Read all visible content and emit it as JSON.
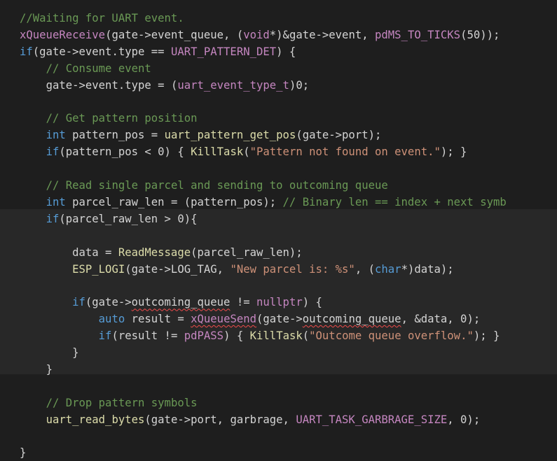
{
  "colors": {
    "background": "#1e1e1e",
    "current_block": "#282828",
    "plain": "#d4d4d4",
    "comment": "#6a9955",
    "function": "#dcdcaa",
    "keyword": "#569cd6",
    "control": "#c586c0",
    "type": "#4ec9b0",
    "string": "#ce9178",
    "number": "#b5cea8",
    "variable": "#9cdcfe",
    "error_squiggle": "#f14c4c"
  },
  "code": {
    "lines": [
      {
        "indent": 0,
        "tokens": [
          {
            "t": "//Waiting for UART event.",
            "c": "comment"
          }
        ]
      },
      {
        "indent": 0,
        "tokens": [
          {
            "t": "xQueueReceive",
            "c": "control"
          },
          {
            "t": "(gate->event_queue, (",
            "c": "plain"
          },
          {
            "t": "void",
            "c": "control"
          },
          {
            "t": "*)&gate->event, ",
            "c": "plain"
          },
          {
            "t": "pdMS_TO_TICKS",
            "c": "control"
          },
          {
            "t": "(50));",
            "c": "plain"
          }
        ]
      },
      {
        "indent": 0,
        "tokens": [
          {
            "t": "if",
            "c": "keyword"
          },
          {
            "t": "(gate->event.type == ",
            "c": "plain"
          },
          {
            "t": "UART_PATTERN_DET",
            "c": "control"
          },
          {
            "t": ") {",
            "c": "plain"
          }
        ]
      },
      {
        "indent": 1,
        "tokens": [
          {
            "t": "// Consume event",
            "c": "comment"
          }
        ]
      },
      {
        "indent": 1,
        "tokens": [
          {
            "t": "gate->event.type = (",
            "c": "plain"
          },
          {
            "t": "uart_event_type_t",
            "c": "control"
          },
          {
            "t": ")0;",
            "c": "plain"
          }
        ]
      },
      {
        "indent": 0,
        "tokens": []
      },
      {
        "indent": 1,
        "tokens": [
          {
            "t": "// Get pattern position",
            "c": "comment"
          }
        ]
      },
      {
        "indent": 1,
        "tokens": [
          {
            "t": "int",
            "c": "keyword"
          },
          {
            "t": " pattern_pos = ",
            "c": "plain"
          },
          {
            "t": "uart_pattern_get_pos",
            "c": "function"
          },
          {
            "t": "(gate->port);",
            "c": "plain"
          }
        ]
      },
      {
        "indent": 1,
        "tokens": [
          {
            "t": "if",
            "c": "keyword"
          },
          {
            "t": "(pattern_pos < 0) { ",
            "c": "plain"
          },
          {
            "t": "KillTask",
            "c": "function"
          },
          {
            "t": "(",
            "c": "plain"
          },
          {
            "t": "\"Pattern not found on event.\"",
            "c": "string"
          },
          {
            "t": "); }",
            "c": "plain"
          }
        ]
      },
      {
        "indent": 0,
        "tokens": []
      },
      {
        "indent": 1,
        "tokens": [
          {
            "t": "// Read single parcel and sending to outcoming queue",
            "c": "comment"
          }
        ]
      },
      {
        "indent": 1,
        "tokens": [
          {
            "t": "int",
            "c": "keyword"
          },
          {
            "t": " parcel_raw_len = (pattern_pos); ",
            "c": "plain"
          },
          {
            "t": "// Binary len == index + next symb",
            "c": "comment"
          }
        ]
      },
      {
        "indent": 1,
        "tokens": [
          {
            "t": "if",
            "c": "keyword"
          },
          {
            "t": "(parcel_raw_len > 0){",
            "c": "plain"
          }
        ]
      },
      {
        "indent": 0,
        "tokens": []
      },
      {
        "indent": 2,
        "tokens": [
          {
            "t": "data = ",
            "c": "plain"
          },
          {
            "t": "ReadMessage",
            "c": "function"
          },
          {
            "t": "(parcel_raw_len);",
            "c": "plain"
          }
        ]
      },
      {
        "indent": 2,
        "tokens": [
          {
            "t": "ESP_LOGI",
            "c": "function"
          },
          {
            "t": "(gate->LOG_TAG, ",
            "c": "plain"
          },
          {
            "t": "\"New parcel is: %s\"",
            "c": "string"
          },
          {
            "t": ", (",
            "c": "plain"
          },
          {
            "t": "char",
            "c": "keyword"
          },
          {
            "t": "*)data);",
            "c": "plain"
          }
        ]
      },
      {
        "indent": 0,
        "tokens": []
      },
      {
        "indent": 2,
        "tokens": [
          {
            "t": "if",
            "c": "keyword"
          },
          {
            "t": "(gate->",
            "c": "plain"
          },
          {
            "t": "outcoming_queue",
            "c": "plain",
            "err": true
          },
          {
            "t": " != ",
            "c": "plain"
          },
          {
            "t": "nullptr",
            "c": "control"
          },
          {
            "t": ") {",
            "c": "plain"
          }
        ]
      },
      {
        "indent": 3,
        "tokens": [
          {
            "t": "auto",
            "c": "keyword"
          },
          {
            "t": " result = ",
            "c": "plain"
          },
          {
            "t": "xQueueSend",
            "c": "control",
            "err": true
          },
          {
            "t": "(gate->",
            "c": "plain"
          },
          {
            "t": "outcoming_queue",
            "c": "plain",
            "err": true
          },
          {
            "t": ", &data, 0);",
            "c": "plain"
          }
        ]
      },
      {
        "indent": 3,
        "tokens": [
          {
            "t": "if",
            "c": "keyword"
          },
          {
            "t": "(result != ",
            "c": "plain"
          },
          {
            "t": "pdPASS",
            "c": "control"
          },
          {
            "t": ") { ",
            "c": "plain"
          },
          {
            "t": "KillTask",
            "c": "function"
          },
          {
            "t": "(",
            "c": "plain"
          },
          {
            "t": "\"Outcome queue overflow.\"",
            "c": "string"
          },
          {
            "t": "); }",
            "c": "plain"
          }
        ]
      },
      {
        "indent": 2,
        "tokens": [
          {
            "t": "}",
            "c": "plain"
          }
        ]
      },
      {
        "indent": 1,
        "tokens": [
          {
            "t": "}",
            "c": "plain"
          }
        ]
      },
      {
        "indent": 0,
        "tokens": []
      },
      {
        "indent": 1,
        "tokens": [
          {
            "t": "// Drop pattern symbols",
            "c": "comment"
          }
        ]
      },
      {
        "indent": 1,
        "tokens": [
          {
            "t": "uart_read_bytes",
            "c": "function"
          },
          {
            "t": "(gate->port, garbrage, ",
            "c": "plain"
          },
          {
            "t": "UART_TASK_GARBRAGE_SIZE",
            "c": "control"
          },
          {
            "t": ", 0);",
            "c": "plain"
          }
        ]
      },
      {
        "indent": 0,
        "tokens": []
      },
      {
        "indent": 0,
        "tokens": [
          {
            "t": "}",
            "c": "plain"
          }
        ]
      }
    ]
  }
}
